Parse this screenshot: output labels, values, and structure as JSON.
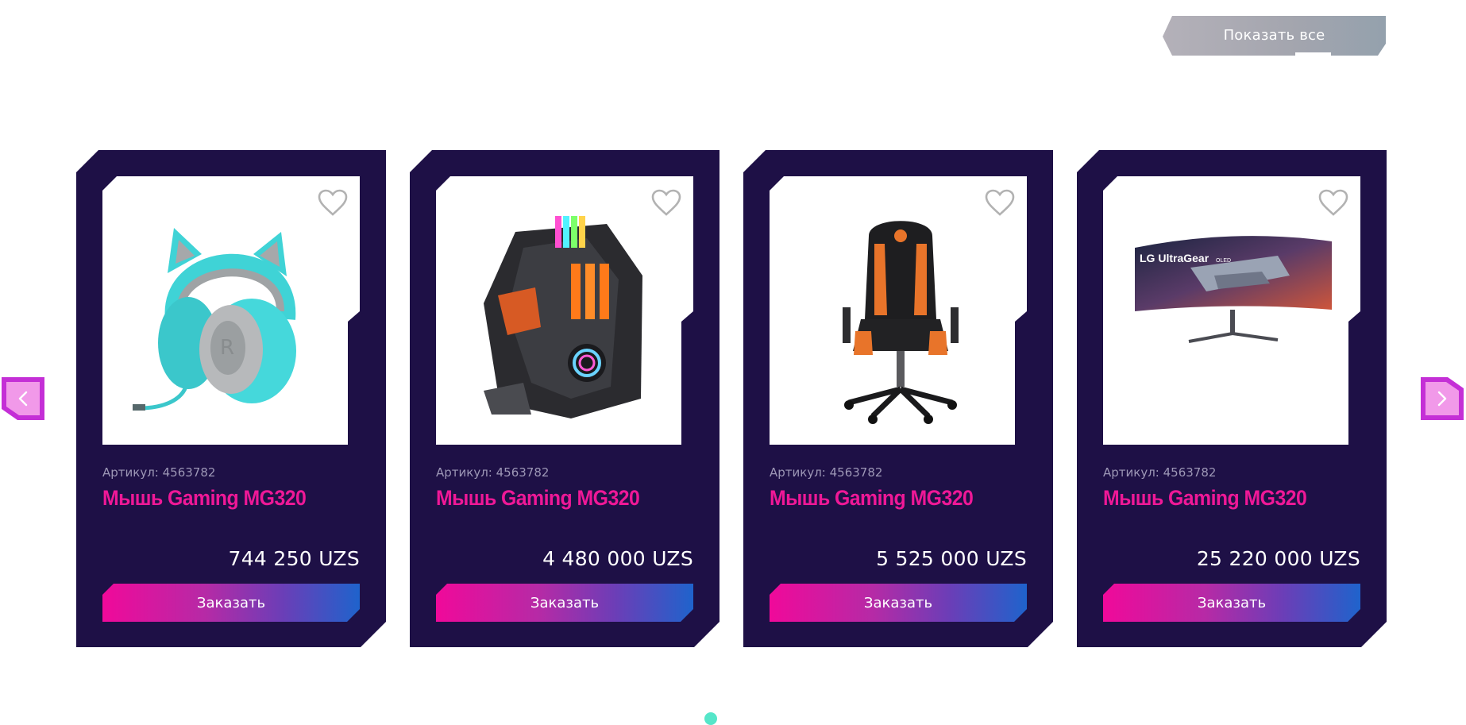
{
  "header": {
    "show_all_label": "Показать все"
  },
  "products": [
    {
      "sku": "Артикул: 4563782",
      "name": "Мышь Gaming MG320",
      "price": "744 250 UZS",
      "order_label": "Заказать",
      "image": "cat-ear-headphones"
    },
    {
      "sku": "Артикул: 4563782",
      "name": "Мышь Gaming MG320",
      "price": "4 480 000 UZS",
      "order_label": "Заказать",
      "image": "gaming-pc-case"
    },
    {
      "sku": "Артикул: 4563782",
      "name": "Мышь Gaming MG320",
      "price": "5 525 000 UZS",
      "order_label": "Заказать",
      "image": "gaming-chair"
    },
    {
      "sku": "Артикул: 4563782",
      "name": "Мышь Gaming MG320",
      "price": "25 220 000 UZS",
      "order_label": "Заказать",
      "image": "curved-monitor"
    }
  ],
  "monitor_screen_text": "LG UltraGear",
  "monitor_screen_subtext": "OLED",
  "colors": {
    "card_bg": "#1e1046",
    "name": "#ef1897",
    "sku": "#9d97b6",
    "order_gradient_start": "#f0099a",
    "order_gradient_end": "#1f63cc",
    "nav_arrow": "#c42fd6",
    "pagination_active": "#55e6c9"
  },
  "pagination": {
    "active_index": 0
  }
}
